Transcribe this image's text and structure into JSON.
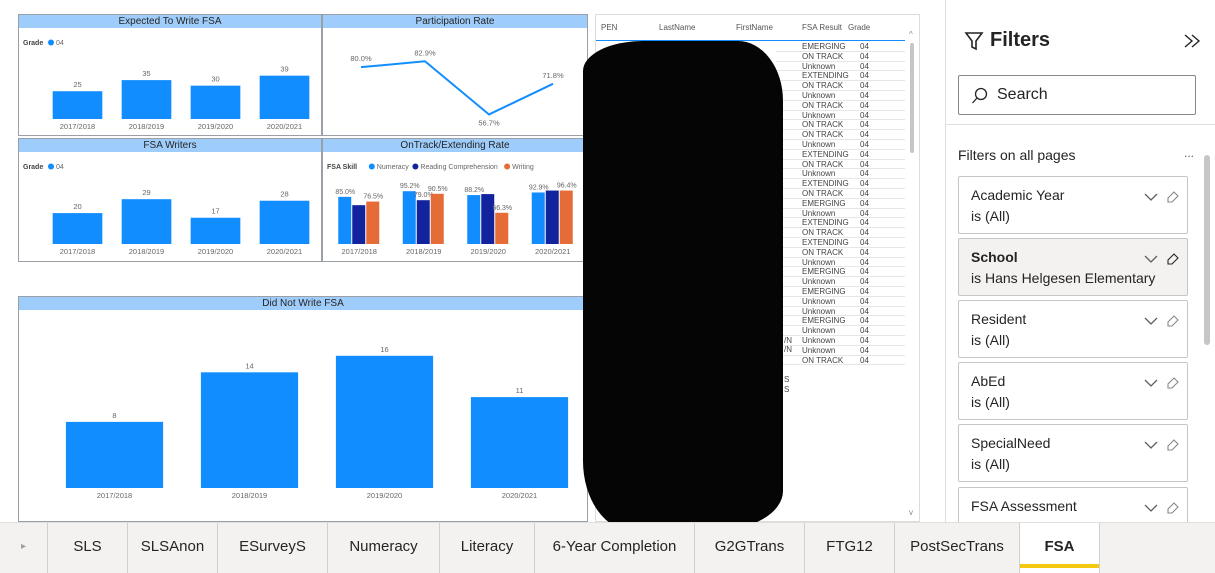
{
  "charts": {
    "expected": {
      "title": "Expected To Write FSA",
      "legend_label": "Grade",
      "legend_item": "04",
      "chart_data": {
        "type": "bar",
        "categories": [
          "2017/2018",
          "2018/2019",
          "2019/2020",
          "2020/2021"
        ],
        "values": [
          25,
          35,
          30,
          39
        ],
        "ylim": [
          0,
          45
        ]
      }
    },
    "participation": {
      "title": "Participation Rate",
      "chart_data": {
        "type": "line",
        "categories": [
          "2017/2018",
          "2018/2019",
          "2019/2020",
          "2020/2021"
        ],
        "values": [
          80.0,
          82.9,
          56.7,
          71.8
        ],
        "value_labels": [
          "80.0%",
          "82.9%",
          "56.7%",
          "71.8%"
        ],
        "ylim": [
          52,
          86
        ]
      }
    },
    "writers": {
      "title": "FSA Writers",
      "legend_label": "Grade",
      "legend_item": "04",
      "chart_data": {
        "type": "bar",
        "categories": [
          "2017/2018",
          "2018/2019",
          "2019/2020",
          "2020/2021"
        ],
        "values": [
          20,
          29,
          17,
          28
        ],
        "ylim": [
          0,
          33
        ]
      }
    },
    "ontrack": {
      "title": "OnTrack/Extending Rate",
      "legend_label": "FSA Skill",
      "chart_data": {
        "type": "bar",
        "categories": [
          "2017/2018",
          "2018/2019",
          "2019/2020",
          "2020/2021"
        ],
        "series": [
          {
            "name": "Numeracy",
            "color": "#118dff",
            "values": [
              85.0,
              95.2,
              88.2,
              92.9
            ],
            "labels": [
              "85.0%",
              "95.2%",
              "88.2%",
              "92.9%"
            ]
          },
          {
            "name": "Reading Comprehension",
            "color": "#12239e",
            "values": [
              70.0,
              79.0,
              90.0,
              96.4
            ],
            "labels": [
              "",
              "79.0%",
              "",
              ""
            ]
          },
          {
            "name": "Writing",
            "color": "#e66c37",
            "values": [
              76.5,
              90.5,
              56.3,
              96.4
            ],
            "labels": [
              "76.5%",
              "90.5%",
              "56.3%",
              "96.4%"
            ]
          }
        ],
        "ylim": [
          0,
          110
        ]
      }
    },
    "didnot": {
      "title": "Did Not Write FSA",
      "chart_data": {
        "type": "bar",
        "categories": [
          "2017/2018",
          "2018/2019",
          "2019/2020",
          "2020/2021"
        ],
        "values": [
          8,
          14,
          16,
          11
        ],
        "ylim": [
          0,
          19
        ]
      }
    }
  },
  "table": {
    "columns": [
      "PEN",
      "LastName",
      "FirstName",
      "FSA Result",
      "Grade"
    ],
    "results": [
      "EMERGING",
      "ON TRACK",
      "Unknown",
      "EXTENDING",
      "ON TRACK",
      "Unknown",
      "ON TRACK",
      "Unknown",
      "ON TRACK",
      "ON TRACK",
      "Unknown",
      "EXTENDING",
      "ON TRACK",
      "Unknown",
      "EXTENDING",
      "ON TRACK",
      "EMERGING",
      "Unknown",
      "EXTENDING",
      "ON TRACK",
      "EXTENDING",
      "ON TRACK",
      "Unknown",
      "EMERGING",
      "Unknown",
      "EMERGING",
      "Unknown",
      "Unknown",
      "EMERGING",
      "Unknown",
      "Unknown",
      "Unknown",
      "ON TRACK"
    ],
    "grade": "04",
    "fragments": [
      {
        "row": 32,
        "text": "/N"
      },
      {
        "row": 33,
        "text": "/N"
      },
      {
        "row": 36,
        "text": "S"
      },
      {
        "row": 37,
        "text": "S"
      }
    ]
  },
  "filters": {
    "title": "Filters",
    "collapse_icon": "double-chevron-right",
    "search_placeholder": "Search",
    "section_label": "Filters on all pages",
    "more": "...",
    "cards": [
      {
        "name": "Academic Year",
        "value": "is (All)",
        "active": false
      },
      {
        "name": "School",
        "value": "is Hans Helgesen Elementary",
        "active": true
      },
      {
        "name": "Resident",
        "value": "is (All)",
        "active": false
      },
      {
        "name": "AbEd",
        "value": "is (All)",
        "active": false
      },
      {
        "name": "SpecialNeed",
        "value": "is (All)",
        "active": false
      },
      {
        "name": "FSA Assessment",
        "value": "",
        "active": false
      }
    ]
  },
  "tabs": {
    "arrow": "▸",
    "items": [
      "SLS",
      "SLSAnon",
      "ESurveyS",
      "Numeracy",
      "Literacy",
      "6-Year Completion",
      "G2GTrans",
      "FTG12",
      "PostSecTrans",
      "FSA"
    ],
    "selected": "FSA"
  },
  "colors": {
    "bar": "#118dff",
    "header": "#9fcdfb",
    "accent": "#f2c811"
  }
}
